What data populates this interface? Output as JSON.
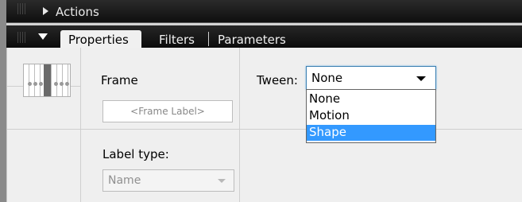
{
  "actions_panel": {
    "label": "Actions"
  },
  "properties_panel": {
    "tabs": [
      {
        "label": "Properties",
        "active": true
      },
      {
        "label": "Filters",
        "active": false
      },
      {
        "label": "Parameters",
        "active": false
      }
    ]
  },
  "frame_section": {
    "title": "Frame",
    "frame_label_placeholder": "<Frame Label>",
    "label_type_title": "Label type:",
    "label_type_value": "Name"
  },
  "tween": {
    "label": "Tween:",
    "value": "None",
    "options": [
      "None",
      "Motion",
      "Shape"
    ],
    "highlighted": "Shape"
  },
  "colors": {
    "selection": "#3399ff",
    "focus_border": "#3c7fb1"
  }
}
